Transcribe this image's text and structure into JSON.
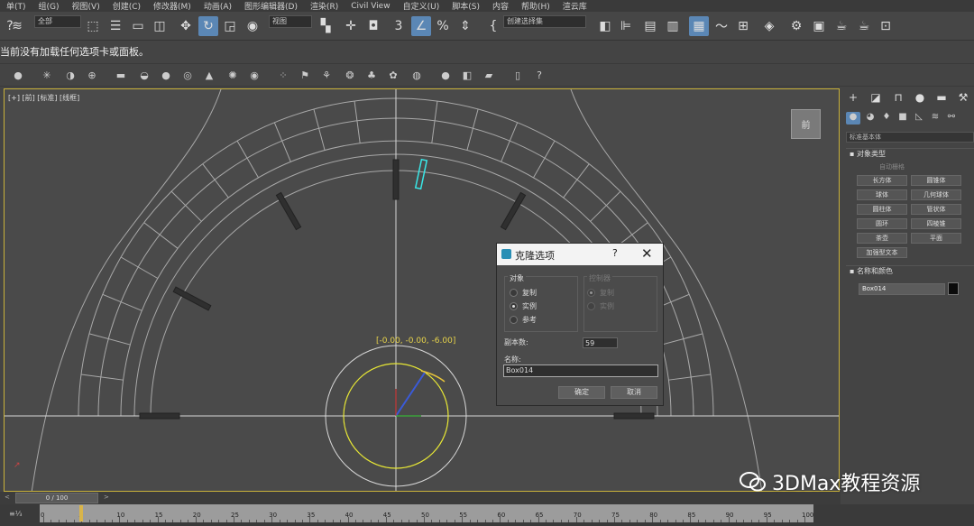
{
  "menu": [
    "单(T)",
    "组(G)",
    "视图(V)",
    "创建(C)",
    "修改器(M)",
    "动画(A)",
    "图形编辑器(D)",
    "渲染(R)",
    "Civil View",
    "自定义(U)",
    "脚本(S)",
    "内容",
    "帮助(H)",
    "渲云库"
  ],
  "toolbar": {
    "selection_filter": "全部",
    "ref_coord": "视图",
    "named_selection": "创建选择集"
  },
  "status_message": "当前没有加载任何选项卡或面板。",
  "viewport": {
    "label": "[+] [前] [标准] [线框]",
    "viewcube_label": "前",
    "transform_coords": "[-0.00, -0.00, -6.00]"
  },
  "clone_dialog": {
    "title": "克隆选项",
    "help_glyph": "?",
    "close_glyph": "✕",
    "object_group": "对象",
    "options": [
      {
        "label": "复制",
        "selected": false
      },
      {
        "label": "实例",
        "selected": true
      },
      {
        "label": "参考",
        "selected": false
      }
    ],
    "controller_group": "控制器",
    "controller_options": [
      {
        "label": "复制",
        "selected": true
      },
      {
        "label": "实例",
        "selected": false
      }
    ],
    "copies_label": "副本数:",
    "copies_value": "59",
    "name_label": "名称:",
    "name_value": "Box014",
    "ok": "确定",
    "cancel": "取消"
  },
  "command_panel": {
    "category": "标准基本体",
    "object_type_header": "对象类型",
    "autogrid": "自动栅格",
    "primitives": [
      "长方体",
      "圆锥体",
      "球体",
      "几何球体",
      "圆柱体",
      "管状体",
      "圆环",
      "四棱锥",
      "茶壶",
      "平面",
      "加强型文本"
    ],
    "name_color_header": "名称和颜色",
    "object_name": "Box014",
    "object_color": "#0b0b0b"
  },
  "time_slider": {
    "position": "0 / 100",
    "left_arrow": "<",
    "right_arrow": ">"
  },
  "track_ticks": [
    "0",
    "5",
    "10",
    "15",
    "20",
    "25",
    "30",
    "35",
    "40",
    "45",
    "50",
    "55",
    "60",
    "65",
    "70",
    "75",
    "80",
    "85",
    "90",
    "95",
    "100"
  ],
  "watermark": "3DMax教程资源",
  "colors": {
    "accent": "#5b87b5",
    "selection_yellow": "#e8d44a",
    "viewport_bg": "#4a4a4a"
  }
}
